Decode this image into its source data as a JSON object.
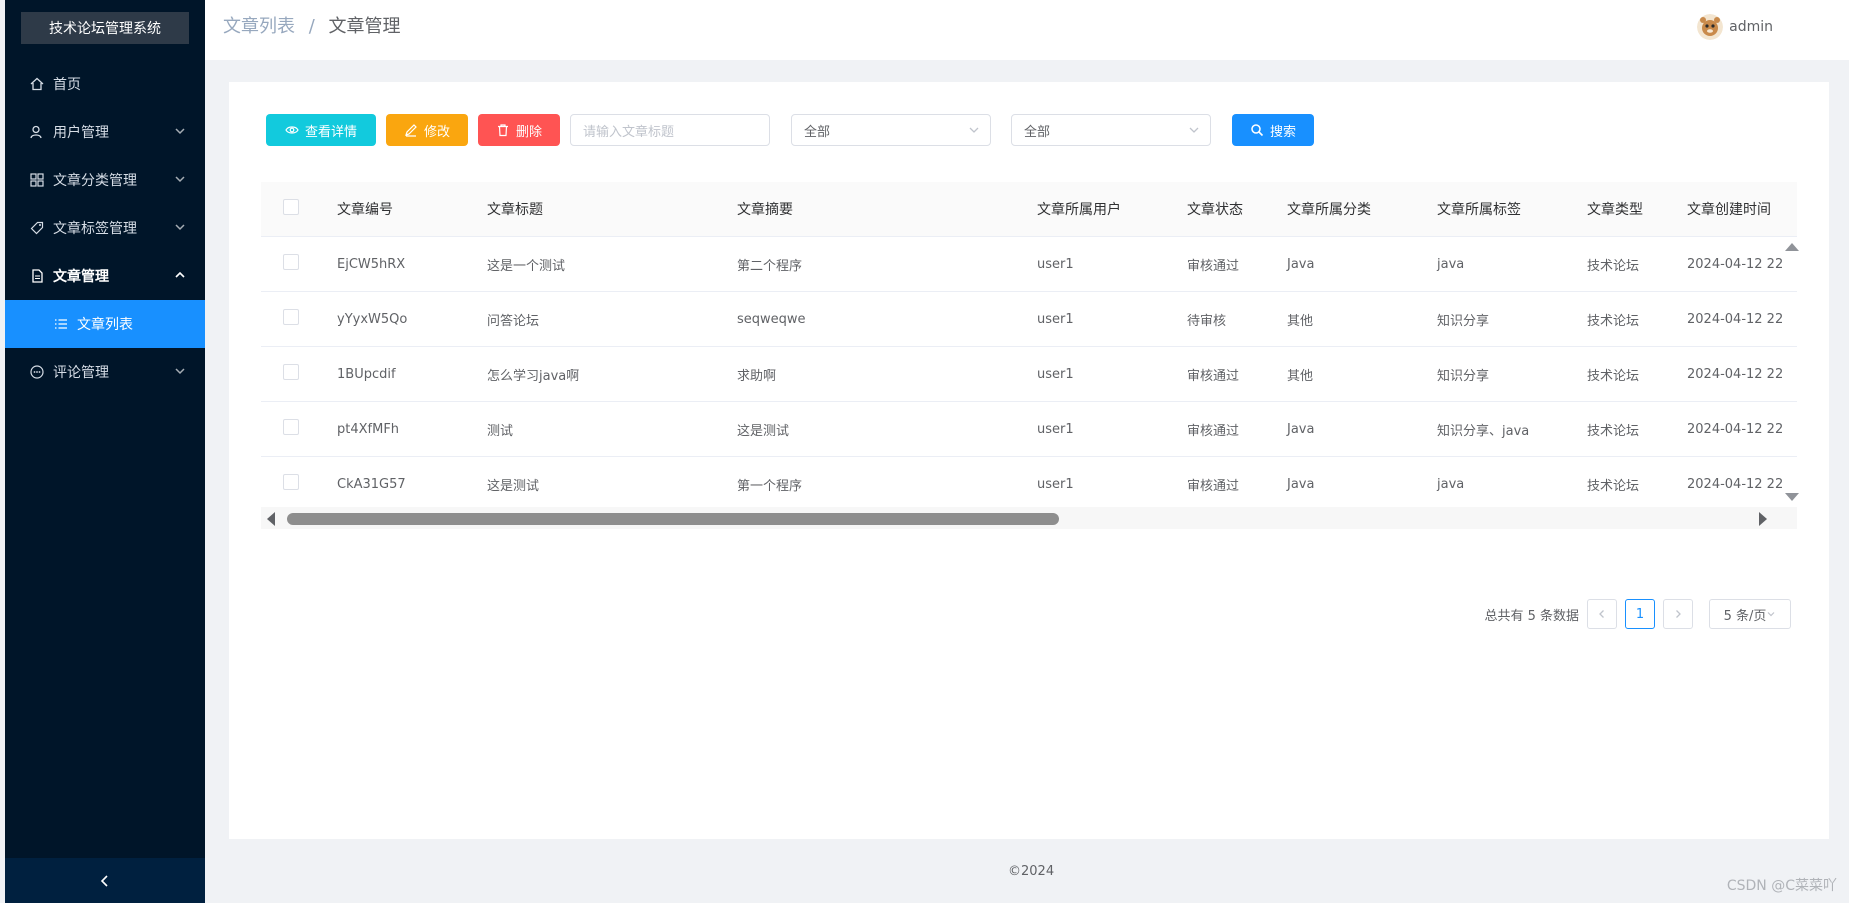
{
  "app": {
    "title": "技术论坛管理系统"
  },
  "sidebar": {
    "items": [
      {
        "label": "首页",
        "icon": "home-icon"
      },
      {
        "label": "用户管理",
        "icon": "user-icon"
      },
      {
        "label": "文章分类管理",
        "icon": "grid-icon"
      },
      {
        "label": "文章标签管理",
        "icon": "tag-icon"
      },
      {
        "label": "文章管理",
        "icon": "document-icon"
      },
      {
        "label": "文章列表",
        "icon": "list-icon"
      },
      {
        "label": "评论管理",
        "icon": "comment-icon"
      }
    ],
    "active_color": "#1890ff",
    "bg_color": "#001529"
  },
  "header": {
    "breadcrumb": [
      "文章列表",
      "文章管理"
    ],
    "separator": "/",
    "user_name": "admin"
  },
  "toolbar": {
    "view_label": "查看详情",
    "edit_label": "修改",
    "delete_label": "删除",
    "title_placeholder": "请输入文章标题",
    "status_select": "全部",
    "category_select": "全部",
    "search_label": "搜索"
  },
  "table": {
    "columns": [
      "文章编号",
      "文章标题",
      "文章摘要",
      "文章所属用户",
      "文章状态",
      "文章所属分类",
      "文章所属标签",
      "文章类型",
      "文章创建时间"
    ],
    "rows": [
      [
        "EjCW5hRX",
        "这是一个测试",
        "第二个程序",
        "user1",
        "审核通过",
        "Java",
        "java",
        "技术论坛",
        "2024-04-12 22"
      ],
      [
        "yYyxW5Qo",
        "问答论坛",
        "seqweqwe",
        "user1",
        "待审核",
        "其他",
        "知识分享",
        "技术论坛",
        "2024-04-12 22"
      ],
      [
        "1BUpcdif",
        "怎么学习java啊",
        "求助啊",
        "user1",
        "审核通过",
        "其他",
        "知识分享",
        "技术论坛",
        "2024-04-12 22"
      ],
      [
        "pt4XfMFh",
        "测试",
        "这是测试",
        "user1",
        "审核通过",
        "Java",
        "知识分享、java",
        "技术论坛",
        "2024-04-12 22"
      ],
      [
        "CkA31G57",
        "这是测试",
        "第一个程序",
        "user1",
        "审核通过",
        "Java",
        "java",
        "技术论坛",
        "2024-04-12 22"
      ]
    ]
  },
  "pagination": {
    "total_text": "总共有 5 条数据",
    "current_page": "1",
    "page_size": "5 条/页"
  },
  "footer": {
    "copyright": "©2024"
  },
  "watermark": "CSDN @C菜菜吖"
}
